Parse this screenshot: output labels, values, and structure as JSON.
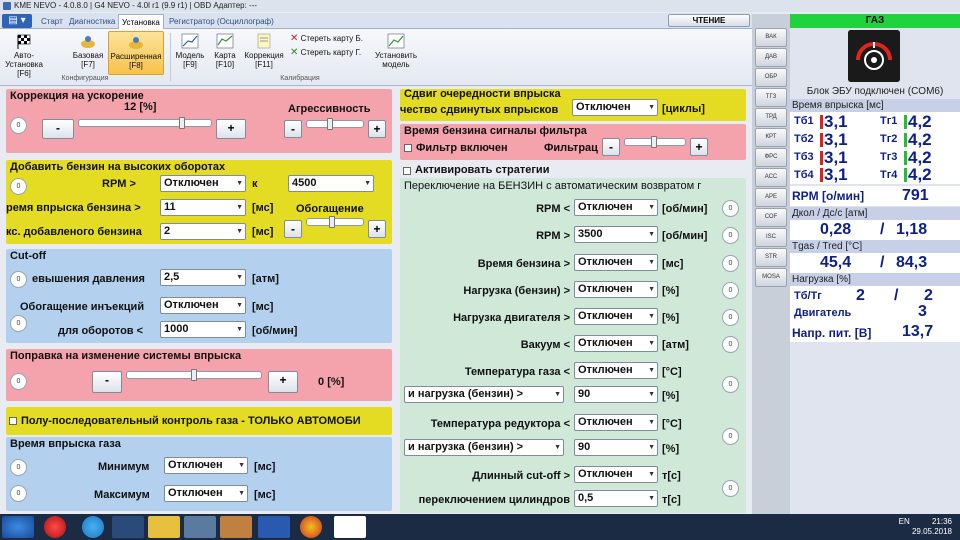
{
  "app": {
    "title": "KME NEVO - 4.0.8.0 | G4 NEVO - 4.0l r1 (9.9 r1) | OBD Адаптер: ---"
  },
  "tabs": {
    "menu": "▤ ▾",
    "items": [
      "Старт",
      "Диагностика",
      "Установка",
      "Регистратор (Осциллограф)"
    ],
    "active": 2
  },
  "read_button": "ЧТЕНИЕ",
  "ribbon": {
    "config_buttons": [
      "Авто-Установка [F6]",
      "Базовая [F7]",
      "Расширенная [F8]"
    ],
    "calib_buttons": [
      "Модель [F9]",
      "Карта [F10]",
      "Коррекция [F11]"
    ],
    "erase_b": "Стереть карту Б.",
    "erase_g": "Стереть карту Г.",
    "set_model": "Установить модель",
    "group_config": "Конфигурация",
    "group_calib": "Калибрация"
  },
  "vstrip": [
    "ВАК",
    "ДАВ",
    "ОБР",
    "ТГЗ",
    "ТРД",
    "КРТ",
    "ФРС",
    "АСС",
    "АРЕ",
    "СОF",
    "ISC",
    "STR",
    "MOSA"
  ],
  "accel": {
    "title": "Коррекция на ускорение",
    "value": "12",
    "unit": "[%]",
    "aggr": "Агрессивность",
    "circ": "0",
    "minus": "-",
    "plus": "+"
  },
  "high_rpm": {
    "title": "Добавить бензин на высоких оборотах",
    "rpm_label": "RPM >",
    "rpm_value": "Отключен",
    "k": "к",
    "rpm2": "4500",
    "inj_label": "ремя впрыска бензина >",
    "inj_value": "11",
    "inj_unit": "[мс]",
    "enrich": "Обогащение",
    "max_label": "кс. добавленого бензина",
    "max_value": "2",
    "max_unit": "[мс]",
    "circ": "0",
    "minus": "-",
    "plus": "+"
  },
  "cutoff": {
    "title": "Cut-off",
    "pres_label": "евышения давления",
    "pres_value": "2,5",
    "pres_unit": "[атм]",
    "enr_label": "Обогащение инъекций",
    "enr_value": "Отключен",
    "enr_unit": "[мс]",
    "rpm_label": "для оборотов <",
    "rpm_value": "1000",
    "rpm_unit": "[об/мин]",
    "circ1": "0",
    "circ2": "0",
    "circ3": "0"
  },
  "sys_change": {
    "title": "Поправка на изменение системы впрыска",
    "value": "0",
    "unit": "[%]",
    "circ": "0",
    "minus": "-",
    "plus": "+"
  },
  "semi_seq": "Полу-последовательный контроль газа - ТОЛЬКО АВТОМОБИ",
  "gas_inj": {
    "title": "Время впрыска газа",
    "min_label": "Минимум",
    "min_value": "Отключен",
    "min_unit": "[мс]",
    "max_label": "Максимум",
    "max_value": "Отключен",
    "max_unit": "[мс]",
    "circ1": "0",
    "circ2": "0"
  },
  "seq_shift": {
    "title": "Сдвиг очередности впрыска",
    "label": "чество сдвинутых впрысков",
    "value": "Отключен",
    "unit": "[циклы]"
  },
  "filter": {
    "title": "Время бензина сигналы фильтра",
    "enabled": "Фильтр включен",
    "filtr": "Фильтрац",
    "minus": "-",
    "plus": "+"
  },
  "strategy": "Активировать стратегии",
  "switch": {
    "title": "Переключение на БЕНЗИН с автоматическим возвратом г",
    "rows": [
      {
        "label": "RPM <",
        "value": "Отключен",
        "unit": "[об/мин]",
        "circ": "0"
      },
      {
        "label": "RPM >",
        "value": "3500",
        "unit": "[об/мин]",
        "circ": "0"
      },
      {
        "label": "Время бензина >",
        "value": "Отключен",
        "unit": "[мс]",
        "circ": "0"
      },
      {
        "label": "Нагрузка (бензин) >",
        "value": "Отключен",
        "unit": "[%]",
        "circ": "0"
      },
      {
        "label": "Нагрузка двигателя >",
        "value": "Отключен",
        "unit": "[%]",
        "circ": "0"
      },
      {
        "label": "Вакуум <",
        "value": "Отключен",
        "unit": "[атм]",
        "circ": "0"
      }
    ],
    "gas_temp_label": "Температура газа <",
    "gas_temp_value": "Отключен",
    "gas_temp_unit": "[°C]",
    "and_load1": "и нагрузка (бензин) >",
    "and_load1_value": "90",
    "and_load1_unit": "[%]",
    "circ_gas": "0",
    "red_temp_label": "Температура редуктора <",
    "red_temp_value": "Отключен",
    "red_temp_unit": "[°C]",
    "and_load2": "и нагрузка (бензин) >",
    "and_load2_value": "90",
    "and_load2_unit": "[%]",
    "circ_red": "0",
    "long_cut_label": "Длинный cut-off >",
    "long_cut_value": "Отключен",
    "long_cut_unit": "т[с]",
    "cyl_label": "переключением цилиндров",
    "cyl_value": "0,5",
    "cyl_unit": "т[с]",
    "circ_long": "0"
  },
  "right": {
    "gas": "ГАЗ",
    "ecu": "Блок ЭБУ подключен (COM6)",
    "inj_time": "Время впрыска [мс]",
    "tb": [
      {
        "n": "Тб1",
        "v": "3,1"
      },
      {
        "n": "Тб2",
        "v": "3,1"
      },
      {
        "n": "Тб3",
        "v": "3,1"
      },
      {
        "n": "Тб4",
        "v": "3,1"
      }
    ],
    "tg": [
      {
        "n": "Тг1",
        "v": "4,2"
      },
      {
        "n": "Тг2",
        "v": "4,2"
      },
      {
        "n": "Тг3",
        "v": "4,2"
      },
      {
        "n": "Тг4",
        "v": "4,2"
      }
    ],
    "rpm_label": "RPM [о/мин]",
    "rpm": "791",
    "pres_label": "Дкол / Дс/с [атм]",
    "pres1": "0,28",
    "slash": "/",
    "pres2": "1,18",
    "temp_label": "Tgas / Tred [°C]",
    "temp1": "45,4",
    "temp2": "84,3",
    "load_label": "Нагрузка [%]",
    "tbtg_label": "Тб/Тг",
    "tb_val": "2",
    "tg_val": "2",
    "engine_label": "Двигатель",
    "engine_val": "3",
    "volt_label": "Напр. пит. [В]",
    "volt": "13,7"
  },
  "tray": {
    "lang": "EN",
    "time": "21:36",
    "date": "29.05.2018"
  }
}
